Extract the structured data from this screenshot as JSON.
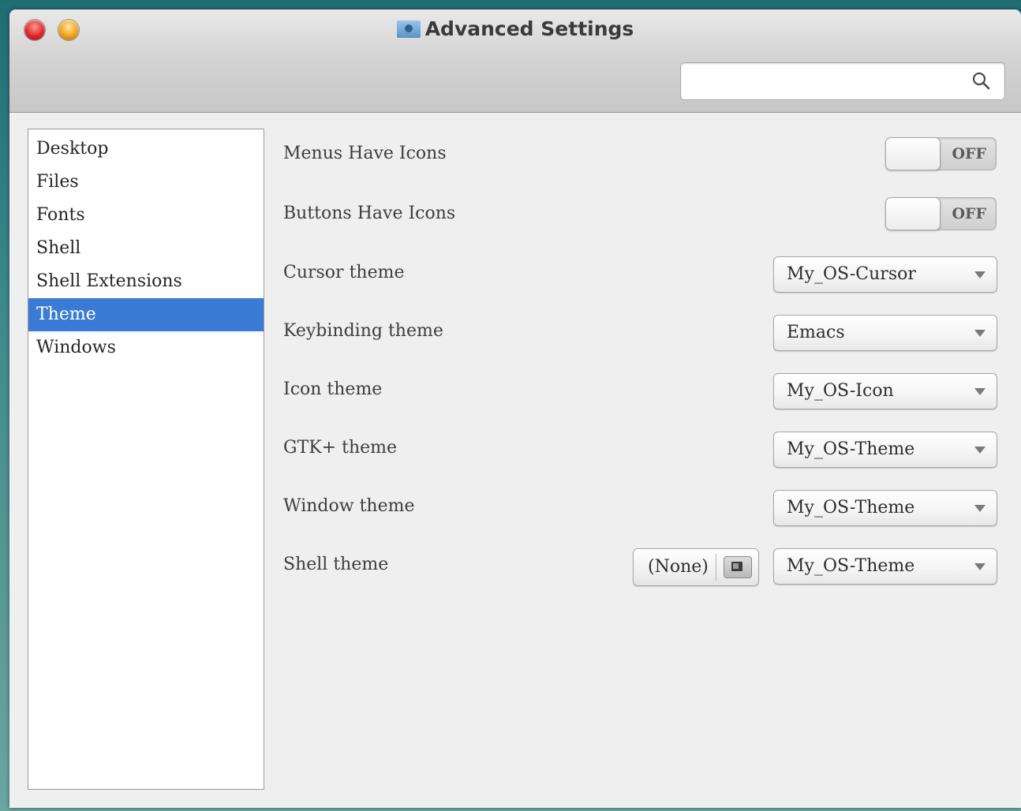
{
  "window": {
    "title": "Advanced Settings",
    "title_icon": "folder-icon",
    "traffic_lights": [
      "close",
      "minimize"
    ]
  },
  "search": {
    "value": "",
    "placeholder": "",
    "icon": "search-icon"
  },
  "sidebar": {
    "items": [
      {
        "label": "Desktop",
        "selected": false
      },
      {
        "label": "Files",
        "selected": false
      },
      {
        "label": "Fonts",
        "selected": false
      },
      {
        "label": "Shell",
        "selected": false
      },
      {
        "label": "Shell Extensions",
        "selected": false
      },
      {
        "label": "Theme",
        "selected": true
      },
      {
        "label": "Windows",
        "selected": false
      }
    ],
    "selected_color": "#3a7bd5"
  },
  "settings": {
    "menus_have_icons": {
      "label": "Menus Have Icons",
      "state": "OFF"
    },
    "buttons_have_icons": {
      "label": "Buttons Have Icons",
      "state": "OFF"
    },
    "cursor_theme": {
      "label": "Cursor theme",
      "value": "My_OS-Cursor"
    },
    "keybinding_theme": {
      "label": "Keybinding theme",
      "value": "Emacs"
    },
    "icon_theme": {
      "label": "Icon theme",
      "value": "My_OS-Icon"
    },
    "gtk_theme": {
      "label": "GTK+ theme",
      "value": "My_OS-Theme"
    },
    "window_theme": {
      "label": "Window theme",
      "value": "My_OS-Theme"
    },
    "shell_theme": {
      "label": "Shell theme",
      "file_button": "(None)",
      "value": "My_OS-Theme"
    }
  }
}
